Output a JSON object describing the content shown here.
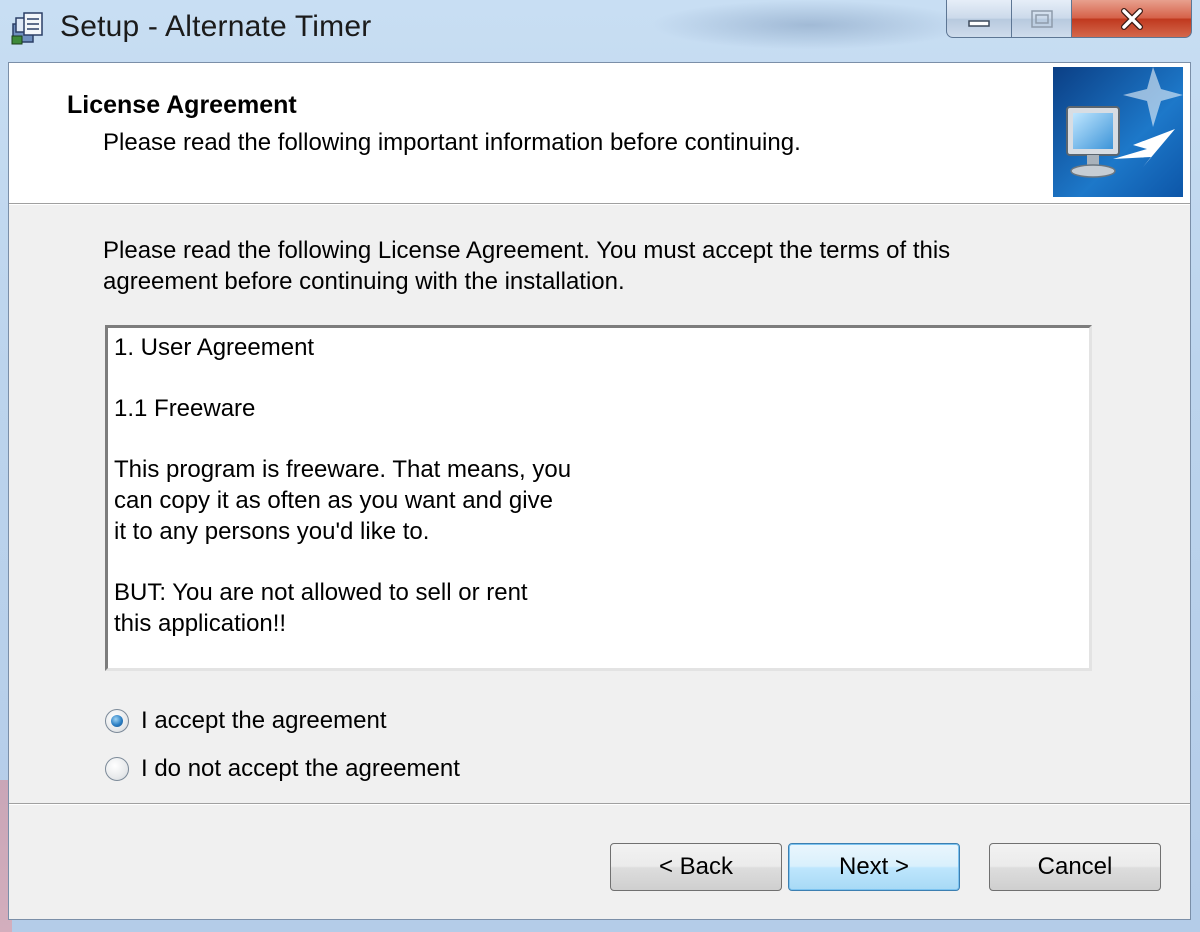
{
  "window": {
    "title": "Setup - Alternate Timer",
    "buttons": {
      "minimize": "minimize",
      "maximize": "maximize",
      "close": "close"
    }
  },
  "header": {
    "title": "License Agreement",
    "subtitle": "Please read the following important information before continuing."
  },
  "intro": {
    "line1": "Please read the following License Agreement. You must accept the terms of this",
    "line2": "agreement before continuing with the installation."
  },
  "license_text": [
    "1. User Agreement",
    "",
    "1.1 Freeware",
    "",
    "This program is freeware. That means, you",
    "can copy it as often as you want and give",
    "it to any persons you'd like to.",
    "",
    "BUT: You are not allowed to sell or rent",
    "this application!!"
  ],
  "options": {
    "accept": {
      "label": "I accept the agreement",
      "selected": true
    },
    "decline": {
      "label": "I do not accept the agreement",
      "selected": false
    }
  },
  "footer": {
    "back": "< Back",
    "next": "Next >",
    "cancel": "Cancel"
  },
  "colors": {
    "frame": "#bcd4ed",
    "client": "#f0f0f0",
    "close_button": "#c0391f",
    "default_button_border": "#3c7fb1"
  },
  "icons": {
    "app": "setup-installer-icon",
    "wizard": "computer-monitor-arrow-icon"
  }
}
